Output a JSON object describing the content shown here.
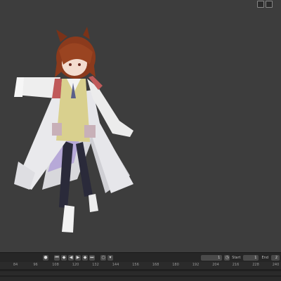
{
  "viewport": {
    "background": "#3d3d3d"
  },
  "timeline": {
    "current_frame": "1",
    "start_label": "Start",
    "start_value": "1",
    "end_label": "End",
    "end_value": "2",
    "ruler_ticks": [
      "84",
      "96",
      "108",
      "120",
      "132",
      "144",
      "156",
      "168",
      "180",
      "192",
      "204",
      "216",
      "228",
      "240"
    ]
  },
  "icons": {
    "viewport_overlay": [
      "overlay-toggle-icon",
      "gizmo-toggle-icon"
    ],
    "playback": [
      "jump-start-icon",
      "prev-keyframe-icon",
      "play-reverse-icon",
      "play-icon",
      "next-keyframe-icon",
      "jump-end-icon"
    ]
  }
}
